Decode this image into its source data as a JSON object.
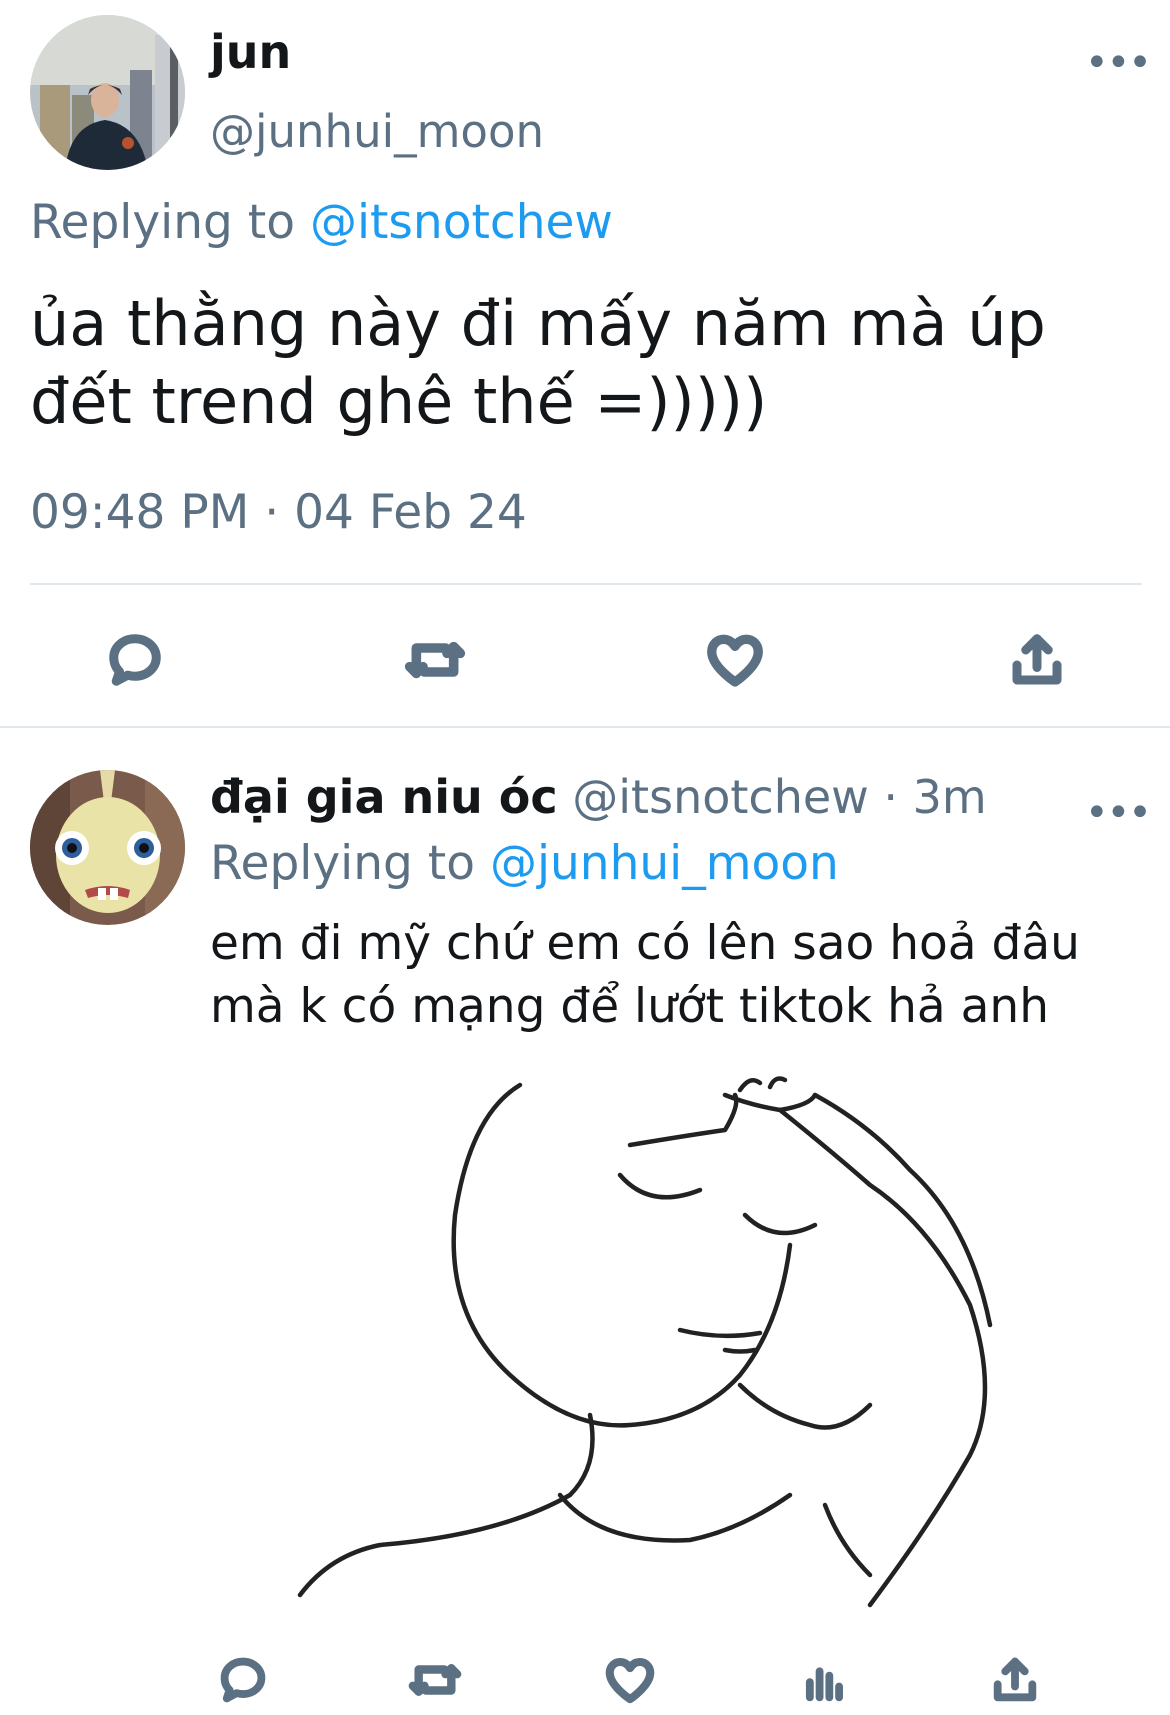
{
  "main_tweet": {
    "display_name": "jun",
    "handle": "@junhui_moon",
    "replying_prefix": "Replying to",
    "replying_to": "@itsnotchew",
    "text": "ủa thằng này đi mấy năm mà úp đết trend ghê thế =)))))",
    "timestamp": "09:48 PM · 04 Feb 24",
    "more_icon": "more-horizontal-icon",
    "actions": [
      "reply-icon",
      "retweet-icon",
      "like-icon",
      "share-icon"
    ]
  },
  "reply_tweet": {
    "display_name": "đại gia niu óc",
    "handle": "@itsnotchew",
    "separator": "·",
    "time_ago": "3m",
    "replying_prefix": "Replying to",
    "replying_to": "@junhui_moon",
    "text": "em đi mỹ chứ em có lên sao hoả đâu mà k có mạng để lướt tiktok hả anh",
    "media": "line-drawing-facepalm-meme",
    "more_icon": "more-horizontal-icon",
    "actions": [
      "reply-icon",
      "retweet-icon",
      "like-icon",
      "analytics-icon",
      "share-icon"
    ]
  },
  "colors": {
    "text": "#14171a",
    "secondary": "#5b7083",
    "link": "#1d9bf0",
    "divider": "#e1e8ed"
  }
}
